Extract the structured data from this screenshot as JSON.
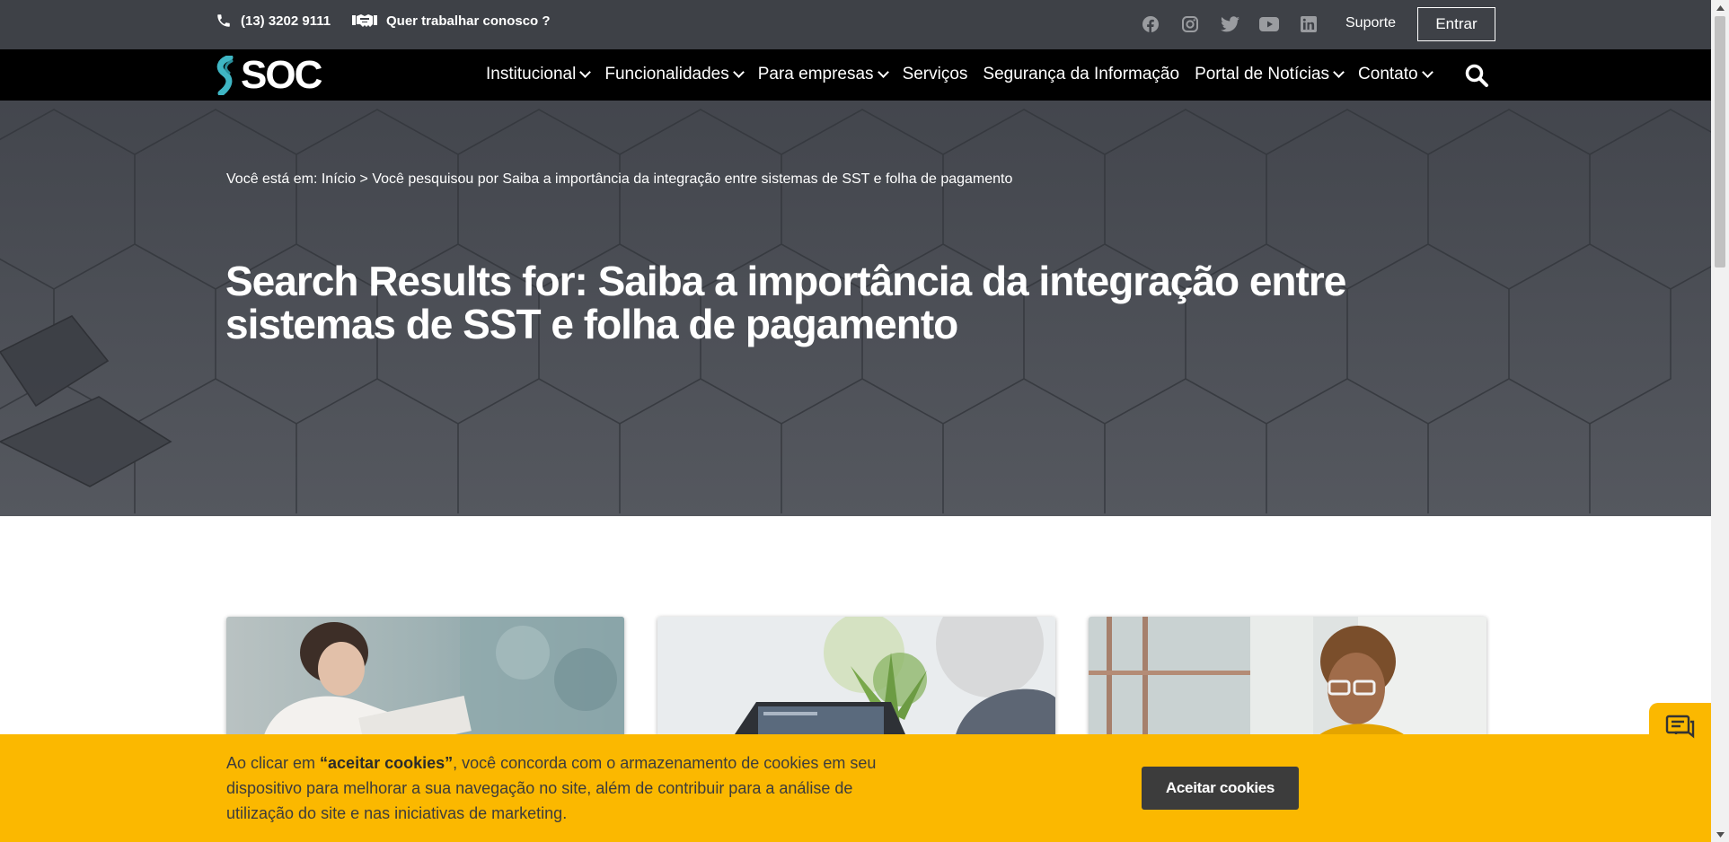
{
  "topbar": {
    "phone": "(13) 3202 9111",
    "work_link": "Quer trabalhar conosco ?",
    "socials": [
      "facebook-icon",
      "instagram-icon",
      "twitter-icon",
      "youtube-icon",
      "linkedin-icon"
    ],
    "support": "Suporte",
    "login": "Entrar"
  },
  "nav": {
    "logo_text": "SOC",
    "items": [
      {
        "label": "Institucional",
        "dropdown": true
      },
      {
        "label": "Funcionalidades",
        "dropdown": true
      },
      {
        "label": "Para empresas",
        "dropdown": true
      },
      {
        "label": "Serviços",
        "dropdown": false
      },
      {
        "label": "Segurança da Informação",
        "dropdown": false
      },
      {
        "label": "Portal de Notícias",
        "dropdown": true
      },
      {
        "label": "Contato",
        "dropdown": true
      }
    ]
  },
  "hero": {
    "breadcrumb_prefix": "Você está em:",
    "breadcrumb_home": "Início",
    "breadcrumb_sep": ">",
    "breadcrumb_current": "Você pesquisou por Saiba a importância da integração entre sistemas de SST e folha de pagamento",
    "title": "Search Results for: Saiba a importância da integração entre sistemas de SST e folha de pagamento"
  },
  "cookie": {
    "text_before": "Ao clicar em ",
    "text_strong": "“aceitar cookies”",
    "text_after": ", você concorda com o armazenamento de cookies em seu dispositivo para melhorar a sua navegação no site, além de contribuir para a análise de utilização do site e nas iniciativas de marketing.",
    "button": "Aceitar cookies"
  },
  "colors": {
    "topbar": "#3e4147",
    "nav": "#000000",
    "hero": "#4a4d55",
    "cookie": "#fbb800",
    "button_dark": "#3c3c3c"
  }
}
